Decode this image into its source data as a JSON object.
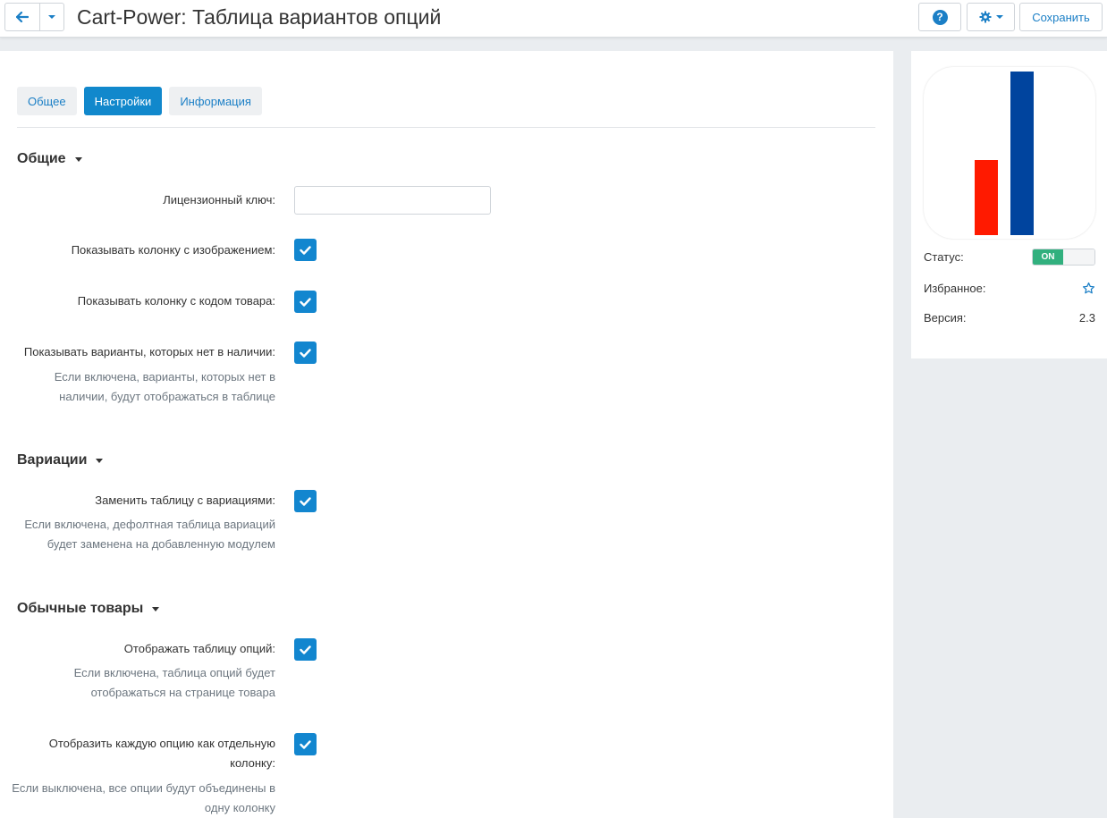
{
  "header": {
    "title": "Cart-Power: Таблица вариантов опций",
    "save_label": "Сохранить"
  },
  "tabs": [
    {
      "label": "Общее",
      "active": false
    },
    {
      "label": "Настройки",
      "active": true
    },
    {
      "label": "Информация",
      "active": false
    }
  ],
  "sections": {
    "general": {
      "title": "Общие",
      "license_label": "Лицензионный ключ:",
      "license_value": "",
      "show_image_label": "Показывать колонку с изображением:",
      "show_image_checked": true,
      "show_code_label": "Показывать колонку с кодом товара:",
      "show_code_checked": true,
      "show_oos_label": "Показывать варианты, которых нет в наличии:",
      "show_oos_checked": true,
      "show_oos_hint": "Если включена, варианты, которых нет в наличии, будут отображаться в таблице"
    },
    "variations": {
      "title": "Вариации",
      "replace_label": "Заменить таблицу с вариациями:",
      "replace_checked": true,
      "replace_hint": "Если включена, дефолтная таблица вариаций будет заменена на добавленную модулем"
    },
    "regular": {
      "title": "Обычные товары",
      "show_table_label": "Отображать таблицу опций:",
      "show_table_checked": true,
      "show_table_hint": "Если включена, таблица опций будет отображаться на странице товара",
      "separate_label": "Отобразить каждую опцию как отдельную колонку:",
      "separate_checked": true,
      "separate_hint": "Если выключена, все опции будут объединены в одну колонку"
    }
  },
  "sidebar": {
    "status_label": "Статус:",
    "status_value": "ON",
    "favorite_label": "Избранное:",
    "version_label": "Версия:",
    "version_value": "2.3"
  },
  "colors": {
    "accent": "#1188cc",
    "status_on": "#31b07e",
    "logo_red": "#ff1a00",
    "logo_blue": "#00449e"
  }
}
